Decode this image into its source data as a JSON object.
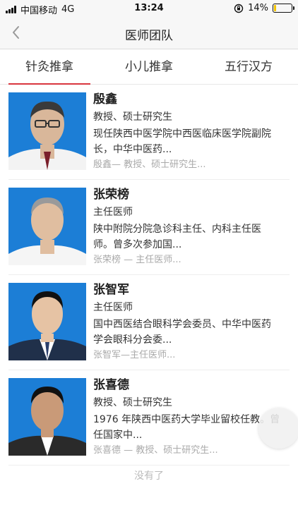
{
  "status_bar": {
    "carrier": "中国移动",
    "network": "4G",
    "time": "13:24",
    "battery_percent": "14%",
    "battery_level": 0.14
  },
  "nav": {
    "title": "医师团队",
    "back_icon": "chevron-left-icon"
  },
  "tabs": [
    {
      "label": "针灸推拿",
      "active": true
    },
    {
      "label": "小儿推拿",
      "active": false
    },
    {
      "label": "五行汉方",
      "active": false
    }
  ],
  "doctors": [
    {
      "name": "殷鑫",
      "title": "教授、硕士研究生",
      "desc_line1": "现任陕西中医学院中西医临床医学院副院",
      "desc_line2": "长，中华中医药...",
      "meta": "殷鑫— 教授、硕士研究生..."
    },
    {
      "name": "张荣榜",
      "title": "主任医师",
      "desc_line1": "陕中附院分院急诊科主任、内科主任医",
      "desc_line2": "师。曾多次参加国...",
      "meta": "张荣榜 — 主任医师..."
    },
    {
      "name": "张智军",
      "title": "主任医师",
      "desc_line1": "国中西医结合眼科学会委员、中华中医药",
      "desc_line2": "学会眼科分会委...",
      "meta": "张智军—主任医师..."
    },
    {
      "name": "张喜德",
      "title": "教授、硕士研究生",
      "desc_line1": "1976 年陕西中医药大学毕业留校任教。曾",
      "desc_line2": "任国家中...",
      "meta": "张喜德 — 教授、硕士研究生..."
    }
  ],
  "footer": {
    "end_text": "没有了"
  },
  "colors": {
    "accent": "#d9363e",
    "photo_bg": "#1c7ed6"
  }
}
